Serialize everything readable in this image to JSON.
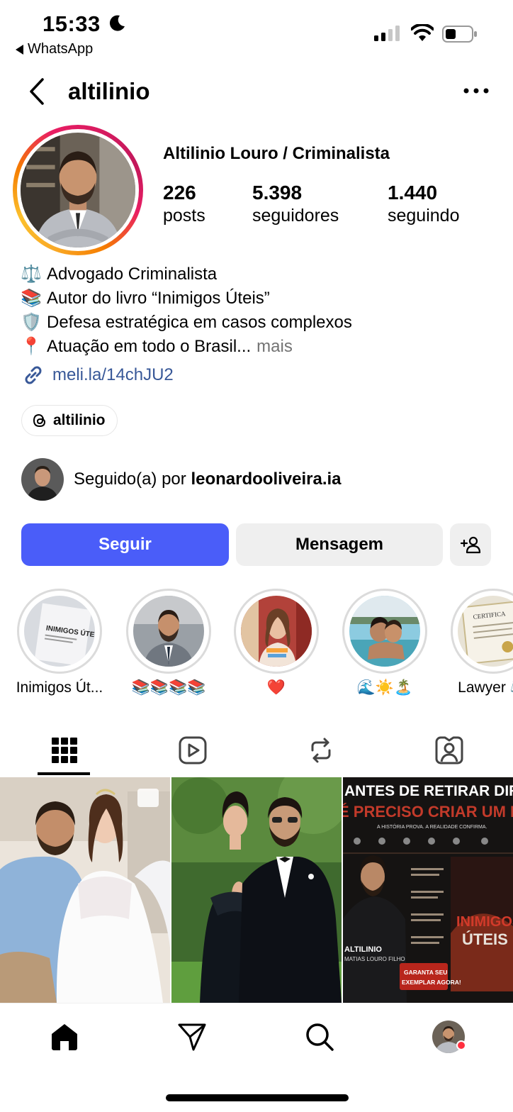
{
  "status_bar": {
    "time": "15:33",
    "back_app": "WhatsApp",
    "icons": [
      "moon-icon",
      "signal-icon",
      "wifi-icon",
      "battery-icon"
    ]
  },
  "header": {
    "username": "altilinio",
    "icons": [
      "back-chevron-icon",
      "more-icon"
    ]
  },
  "profile": {
    "full_name": "Altilinio Louro / Criminalista",
    "stats": {
      "posts_count": "226",
      "posts_label": "posts",
      "followers_count": "5.398",
      "followers_label": "seguidores",
      "following_count": "1.440",
      "following_label": "seguindo"
    },
    "bio": {
      "line1_icon": "⚖️",
      "line1": "Advogado Criminalista",
      "line2_icon": "📚",
      "line2": "Autor do livro “Inimigos Úteis”",
      "line3_icon": "🛡️",
      "line3": "Defesa estratégica em casos complexos",
      "line4_icon": "📍",
      "line4": "Atuação em todo o Brasil...",
      "more": "mais"
    },
    "link": "meli.la/14chJU2",
    "threads_handle": "altilinio",
    "followed_by_prefix": "Seguido(a) por ",
    "followed_by_user": "leonardooliveira.ia"
  },
  "actions": {
    "follow": "Seguir",
    "message": "Mensagem"
  },
  "highlights": [
    {
      "label": "Inimigos Út..."
    },
    {
      "label": "📚📚📚📚"
    },
    {
      "label": "❤️"
    },
    {
      "label": "🌊☀️🏝️"
    },
    {
      "label": "Lawyer ⚖️"
    }
  ],
  "highlight_image_texts": {
    "book_title": "INIMIGOS ÚTEIS",
    "certificate": "CERTIFICA"
  },
  "tabs": [
    "grid-icon",
    "reels-icon",
    "reposts-icon",
    "tagged-icon"
  ],
  "posts": {
    "post3": {
      "headline1": "ANTES DE RETIRAR DIREITOS,",
      "headline2": "É PRECISO CRIAR UM INIMIGO",
      "subhead": "A HISTÓRIA PROVA. A REALIDADE CONFIRMA.",
      "book_title1": "INIMIGOS",
      "book_title2": "ÚTEIS",
      "author1": "ALTILINIO",
      "author2": "MATIAS LOURO FILHO",
      "cta1": "GARANTA SEU",
      "cta2": "EXEMPLAR AGORA!"
    }
  },
  "bottom_nav": [
    "home-icon",
    "send-icon",
    "search-icon",
    "profile-avatar"
  ],
  "colors": {
    "follow_button": "#4a5df9",
    "secondary_button": "#efefef",
    "link": "#385898",
    "muted": "#737373",
    "notification": "#ff3040"
  }
}
